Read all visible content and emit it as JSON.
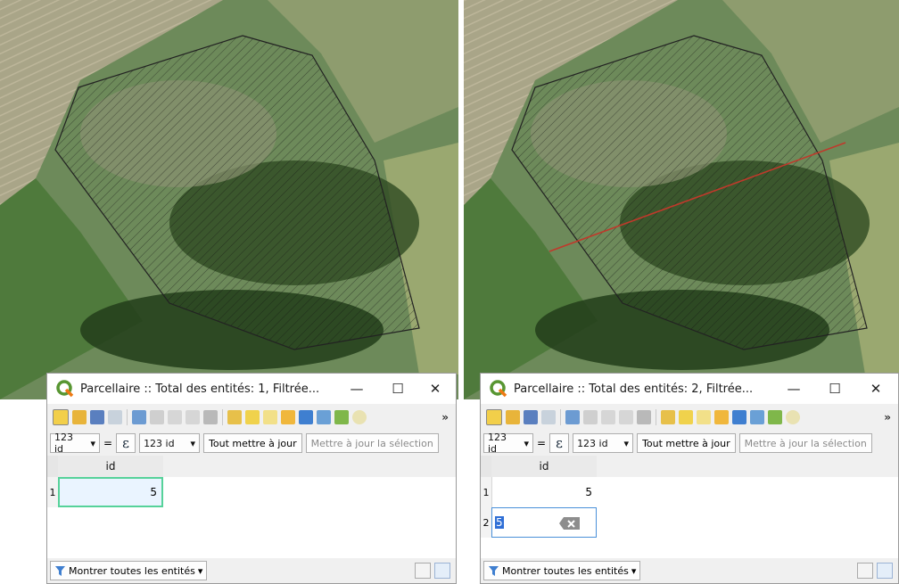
{
  "left": {
    "window": {
      "title": "Parcellaire :: Total des entités: 1, Filtrée...",
      "controls": {
        "minimize": "—",
        "maximize": "☐",
        "close": "✕"
      }
    },
    "toolbar": {
      "more": "»"
    },
    "expr": {
      "field1": "123 id",
      "eq": "=",
      "epsilon": "ε",
      "field2": "123 id",
      "update_all": "Tout mettre à jour",
      "update_sel": "Mettre à jour la sélection"
    },
    "table": {
      "header": "id",
      "rows": [
        {
          "num": "1",
          "value": "5"
        }
      ]
    },
    "status": {
      "show_all": "Montrer toutes les entités"
    }
  },
  "right": {
    "window": {
      "title": "Parcellaire :: Total des entités: 2, Filtrée...",
      "controls": {
        "minimize": "—",
        "maximize": "☐",
        "close": "✕"
      }
    },
    "toolbar": {
      "more": "»"
    },
    "expr": {
      "field1": "123 id",
      "eq": "=",
      "epsilon": "ε",
      "field2": "123 id",
      "update_all": "Tout mettre à jour",
      "update_sel": "Mettre à jour la sélection"
    },
    "table": {
      "header": "id",
      "rows": [
        {
          "num": "1",
          "value": "5"
        },
        {
          "num": "2",
          "value": "5"
        }
      ]
    },
    "status": {
      "show_all": "Montrer toutes les entités"
    }
  },
  "colors": {
    "accent_green": "#56d29a",
    "selection_blue": "#2f6fd6",
    "qgis_green": "#589632",
    "red_line": "#c0392b"
  }
}
